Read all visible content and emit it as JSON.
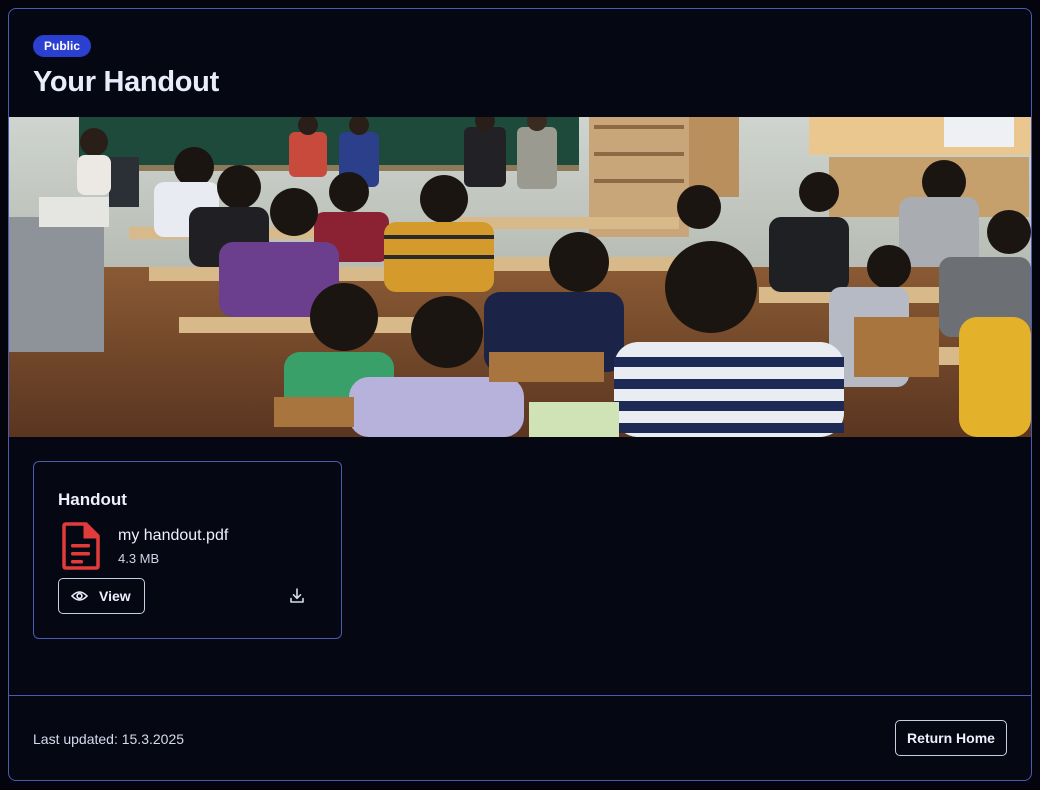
{
  "header": {
    "badge": "Public",
    "title": "Your Handout"
  },
  "hero": {
    "alt": "Classroom with students seated at desks facing the front of the room"
  },
  "handout": {
    "card_title": "Handout",
    "file_name": "my handout.pdf",
    "file_size": "4.3 MB",
    "view_label": "View",
    "file_icon": "document-icon",
    "download_icon": "download-icon",
    "view_icon": "eye-icon"
  },
  "footer": {
    "last_updated": "Last updated: 15.3.2025",
    "return_label": "Return Home"
  },
  "colors": {
    "background": "#050713",
    "border": "#4b5bb0",
    "badge": "#2b3fd0",
    "file_icon": "#e23b3b"
  }
}
